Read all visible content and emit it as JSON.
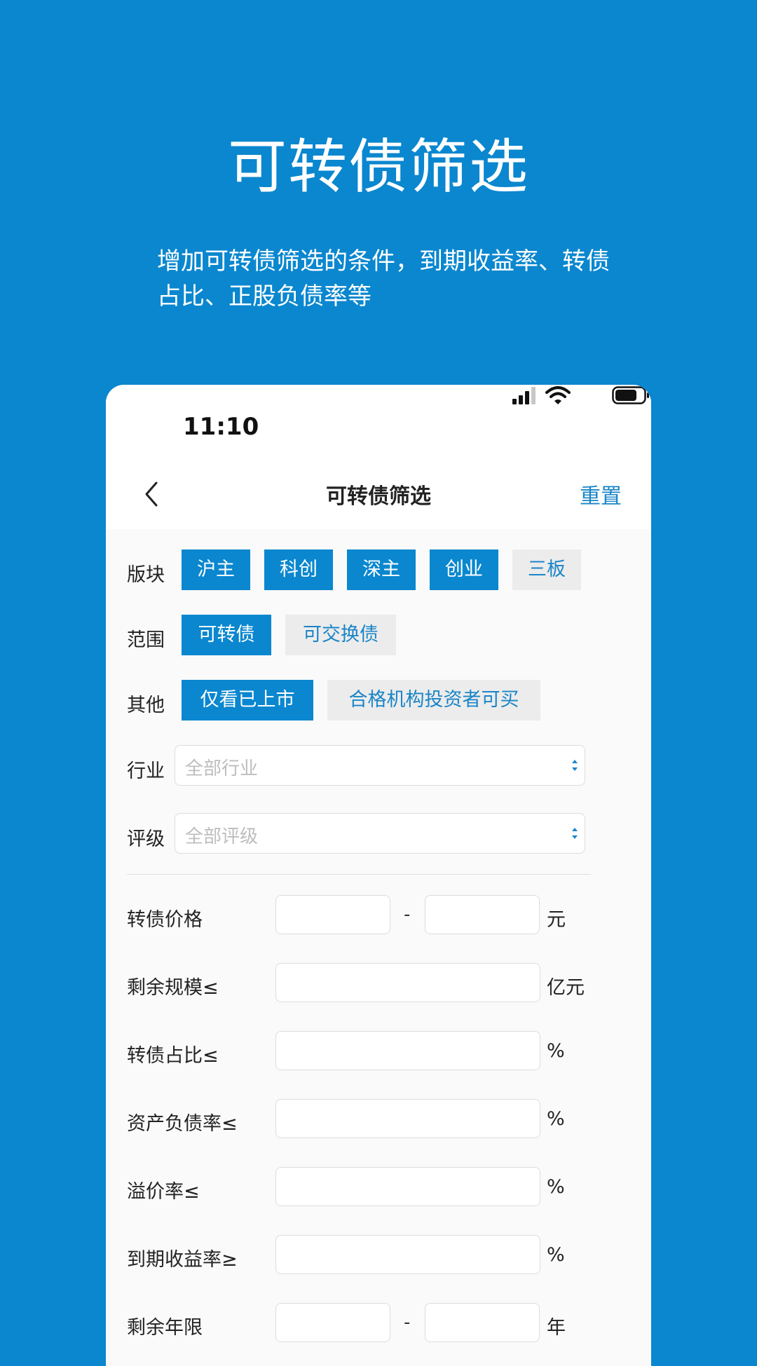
{
  "promo": {
    "title": "可转债筛选",
    "subtitle": "增加可转债筛选的条件，到期收益率、转债占比、正股负债率等"
  },
  "status_bar": {
    "time": "11:10"
  },
  "nav": {
    "title": "可转债筛选",
    "reset": "重置"
  },
  "filters": {
    "sector": {
      "label": "版块",
      "options": [
        {
          "label": "沪主",
          "selected": true
        },
        {
          "label": "科创",
          "selected": true
        },
        {
          "label": "深主",
          "selected": true
        },
        {
          "label": "创业",
          "selected": true
        },
        {
          "label": "三板",
          "selected": false
        }
      ]
    },
    "scope": {
      "label": "范围",
      "options": [
        {
          "label": "可转债",
          "selected": true
        },
        {
          "label": "可交换债",
          "selected": false
        }
      ]
    },
    "other": {
      "label": "其他",
      "options": [
        {
          "label": "仅看已上市",
          "selected": true
        },
        {
          "label": "合格机构投资者可买",
          "selected": false
        }
      ]
    },
    "industry": {
      "label": "行业",
      "value": "全部行业"
    },
    "rating": {
      "label": "评级",
      "value": "全部评级"
    }
  },
  "fields": {
    "price": {
      "label": "转债价格",
      "unit": "元",
      "min": "",
      "max": "",
      "separator": "-"
    },
    "remaining_scale": {
      "label": "剩余规模≤",
      "unit": "亿元",
      "value": ""
    },
    "bond_ratio": {
      "label": "转债占比≤",
      "unit": "%",
      "value": ""
    },
    "debt_ratio": {
      "label": "资产负债率≤",
      "unit": "%",
      "value": ""
    },
    "premium_rate": {
      "label": "溢价率≤",
      "unit": "%",
      "value": ""
    },
    "ytm": {
      "label": "到期收益率≥",
      "unit": "%",
      "value": ""
    },
    "remaining_years": {
      "label": "剩余年限",
      "unit": "年",
      "min": "",
      "max": "",
      "separator": "-"
    }
  },
  "colors": {
    "brand": "#0A87CF",
    "link": "#1A85C8",
    "chip_off_bg": "#ECECEC"
  }
}
